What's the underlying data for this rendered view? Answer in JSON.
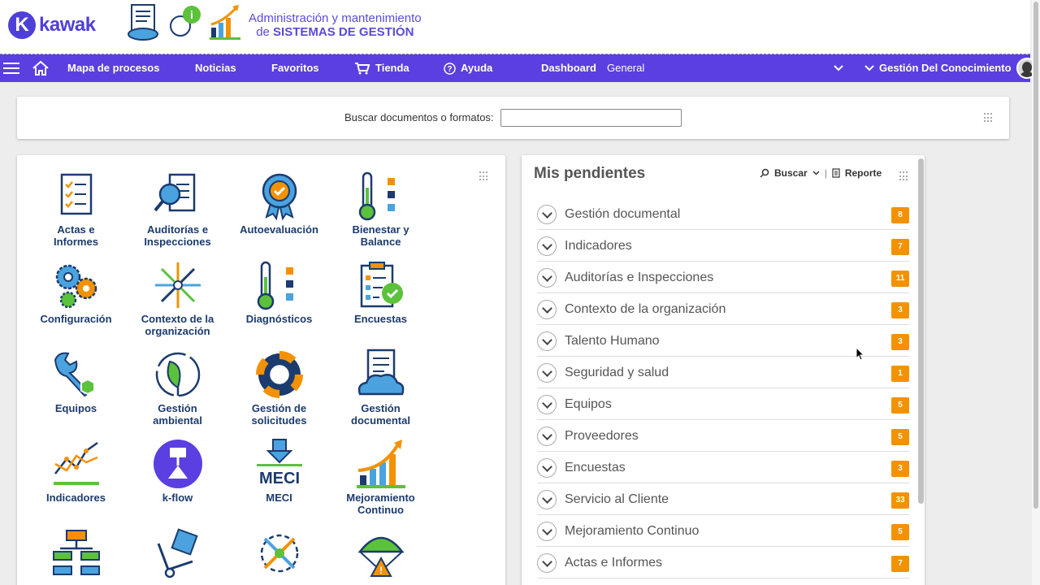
{
  "brand": {
    "logo_text": "kawak",
    "tagline_line1": "Administración y mantenimiento",
    "tagline_prefix": "de ",
    "tagline_bold": "SISTEMAS DE GESTIÓN"
  },
  "nav": {
    "mapa": "Mapa de procesos",
    "noticias": "Noticias",
    "favoritos": "Favoritos",
    "tienda": "Tienda",
    "ayuda": "Ayuda",
    "dashboard_label": "Dashboard",
    "dashboard_value": "General",
    "user_area": "Gestión Del Conocimiento"
  },
  "search": {
    "label": "Buscar documentos o formatos:",
    "value": ""
  },
  "modules": [
    {
      "line1": "Actas e",
      "line2": "Informes"
    },
    {
      "line1": "Auditorías e",
      "line2": "Inspecciones"
    },
    {
      "line1": "Autoevaluación",
      "line2": ""
    },
    {
      "line1": "Bienestar y",
      "line2": "Balance"
    },
    {
      "line1": "Configuración",
      "line2": ""
    },
    {
      "line1": "Contexto de la",
      "line2": "organización"
    },
    {
      "line1": "Diagnósticos",
      "line2": ""
    },
    {
      "line1": "Encuestas",
      "line2": ""
    },
    {
      "line1": "Equipos",
      "line2": ""
    },
    {
      "line1": "Gestión",
      "line2": "ambiental"
    },
    {
      "line1": "Gestión de",
      "line2": "solicitudes"
    },
    {
      "line1": "Gestión",
      "line2": "documental"
    },
    {
      "line1": "Indicadores",
      "line2": ""
    },
    {
      "line1": "k-flow",
      "line2": ""
    },
    {
      "line1": "MECI",
      "line2": ""
    },
    {
      "line1": "Mejoramiento",
      "line2": "Continuo"
    }
  ],
  "meci_icon_text": "MECI",
  "pending": {
    "title": "Mis pendientes",
    "search_label": "Buscar",
    "separator": "|",
    "report_label": "Reporte",
    "items": [
      {
        "label": "Gestión documental",
        "count": "8"
      },
      {
        "label": "Indicadores",
        "count": "7"
      },
      {
        "label": "Auditorías e Inspecciones",
        "count": "11"
      },
      {
        "label": "Contexto de la organización",
        "count": "3"
      },
      {
        "label": "Talento Humano",
        "count": "3"
      },
      {
        "label": "Seguridad y salud",
        "count": "1"
      },
      {
        "label": "Equipos",
        "count": "5"
      },
      {
        "label": "Proveedores",
        "count": "5"
      },
      {
        "label": "Encuestas",
        "count": "3"
      },
      {
        "label": "Servicio al Cliente",
        "count": "33"
      },
      {
        "label": "Mejoramiento Continuo",
        "count": "5"
      },
      {
        "label": "Actas e Informes",
        "count": "7"
      }
    ]
  },
  "colors": {
    "nav_purple": "#5b3fe0",
    "brand_purple": "#4f3fd9",
    "module_label": "#1c3b6e",
    "badge_orange": "#f39200"
  }
}
